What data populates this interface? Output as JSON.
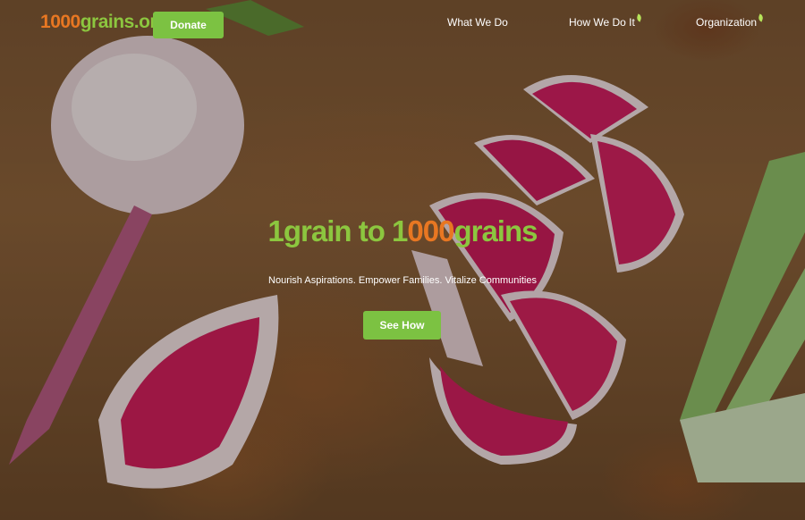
{
  "nav": {
    "logo": {
      "prefix_one": "1",
      "zeros": "000",
      "suffix": "grains.org"
    },
    "donate_label": "Donate",
    "items": [
      {
        "label": "What We Do"
      },
      {
        "label": "How We Do It"
      },
      {
        "label": "Organization"
      }
    ]
  },
  "hero": {
    "headline": {
      "part1": "1grain to ",
      "part2": "1",
      "part3": "000",
      "part4": "grains"
    },
    "subtitle": "Nourish Aspirations. Empower Families. Vitalize Communities",
    "cta_label": "See How"
  },
  "colors": {
    "accent_green": "#7cc242",
    "logo_orange": "#e87722",
    "logo_green": "#8cc63f"
  }
}
